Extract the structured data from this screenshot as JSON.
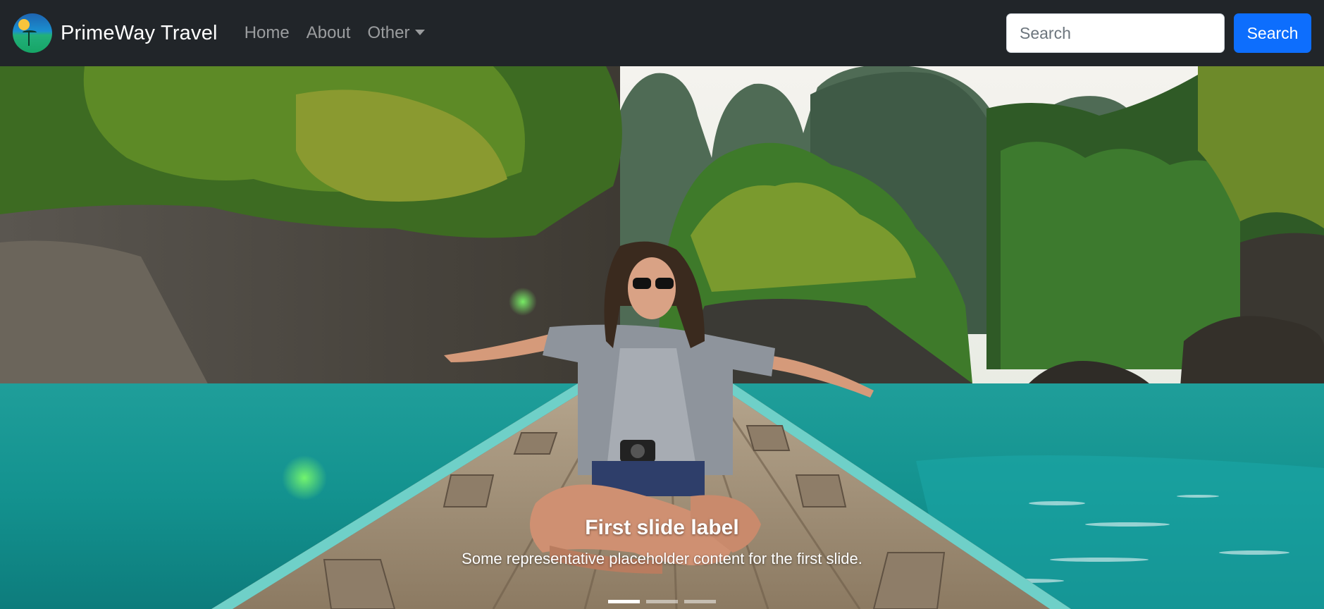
{
  "navbar": {
    "brand": "PrimeWay Travel",
    "links": [
      {
        "label": "Home"
      },
      {
        "label": "About"
      },
      {
        "label": "Other"
      }
    ],
    "search_placeholder": "Search",
    "search_button": "Search"
  },
  "carousel": {
    "slide_title": "First slide label",
    "slide_text": "Some representative placeholder content for the first slide.",
    "indicator_count": 3,
    "active_index": 0
  },
  "colors": {
    "navbar_bg": "#212529",
    "primary": "#0d6efd",
    "water": "#13a3a0",
    "foliage": "#3f7a2a"
  },
  "icons": {
    "logo": "palm-sun-globe-icon",
    "dropdown": "caret-down-icon"
  }
}
